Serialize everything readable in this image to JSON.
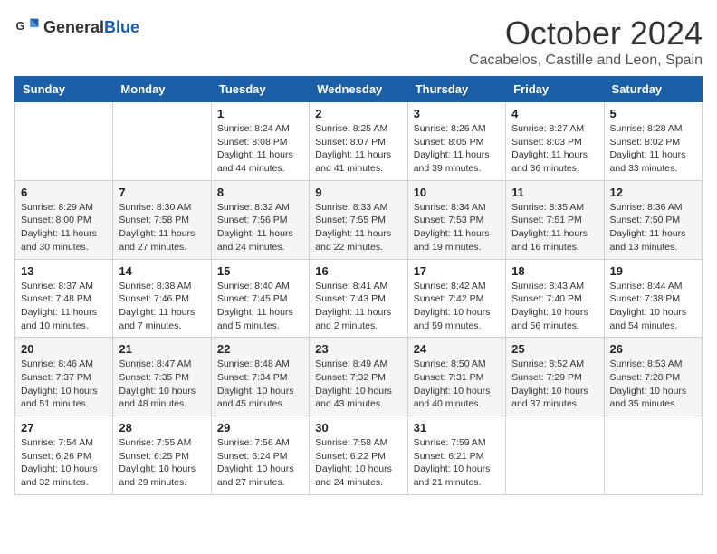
{
  "header": {
    "logo_general": "General",
    "logo_blue": "Blue",
    "month": "October 2024",
    "location": "Cacabelos, Castille and Leon, Spain"
  },
  "days_of_week": [
    "Sunday",
    "Monday",
    "Tuesday",
    "Wednesday",
    "Thursday",
    "Friday",
    "Saturday"
  ],
  "weeks": [
    [
      {
        "day": "",
        "content": ""
      },
      {
        "day": "",
        "content": ""
      },
      {
        "day": "1",
        "content": "Sunrise: 8:24 AM\nSunset: 8:08 PM\nDaylight: 11 hours and 44 minutes."
      },
      {
        "day": "2",
        "content": "Sunrise: 8:25 AM\nSunset: 8:07 PM\nDaylight: 11 hours and 41 minutes."
      },
      {
        "day": "3",
        "content": "Sunrise: 8:26 AM\nSunset: 8:05 PM\nDaylight: 11 hours and 39 minutes."
      },
      {
        "day": "4",
        "content": "Sunrise: 8:27 AM\nSunset: 8:03 PM\nDaylight: 11 hours and 36 minutes."
      },
      {
        "day": "5",
        "content": "Sunrise: 8:28 AM\nSunset: 8:02 PM\nDaylight: 11 hours and 33 minutes."
      }
    ],
    [
      {
        "day": "6",
        "content": "Sunrise: 8:29 AM\nSunset: 8:00 PM\nDaylight: 11 hours and 30 minutes."
      },
      {
        "day": "7",
        "content": "Sunrise: 8:30 AM\nSunset: 7:58 PM\nDaylight: 11 hours and 27 minutes."
      },
      {
        "day": "8",
        "content": "Sunrise: 8:32 AM\nSunset: 7:56 PM\nDaylight: 11 hours and 24 minutes."
      },
      {
        "day": "9",
        "content": "Sunrise: 8:33 AM\nSunset: 7:55 PM\nDaylight: 11 hours and 22 minutes."
      },
      {
        "day": "10",
        "content": "Sunrise: 8:34 AM\nSunset: 7:53 PM\nDaylight: 11 hours and 19 minutes."
      },
      {
        "day": "11",
        "content": "Sunrise: 8:35 AM\nSunset: 7:51 PM\nDaylight: 11 hours and 16 minutes."
      },
      {
        "day": "12",
        "content": "Sunrise: 8:36 AM\nSunset: 7:50 PM\nDaylight: 11 hours and 13 minutes."
      }
    ],
    [
      {
        "day": "13",
        "content": "Sunrise: 8:37 AM\nSunset: 7:48 PM\nDaylight: 11 hours and 10 minutes."
      },
      {
        "day": "14",
        "content": "Sunrise: 8:38 AM\nSunset: 7:46 PM\nDaylight: 11 hours and 7 minutes."
      },
      {
        "day": "15",
        "content": "Sunrise: 8:40 AM\nSunset: 7:45 PM\nDaylight: 11 hours and 5 minutes."
      },
      {
        "day": "16",
        "content": "Sunrise: 8:41 AM\nSunset: 7:43 PM\nDaylight: 11 hours and 2 minutes."
      },
      {
        "day": "17",
        "content": "Sunrise: 8:42 AM\nSunset: 7:42 PM\nDaylight: 10 hours and 59 minutes."
      },
      {
        "day": "18",
        "content": "Sunrise: 8:43 AM\nSunset: 7:40 PM\nDaylight: 10 hours and 56 minutes."
      },
      {
        "day": "19",
        "content": "Sunrise: 8:44 AM\nSunset: 7:38 PM\nDaylight: 10 hours and 54 minutes."
      }
    ],
    [
      {
        "day": "20",
        "content": "Sunrise: 8:46 AM\nSunset: 7:37 PM\nDaylight: 10 hours and 51 minutes."
      },
      {
        "day": "21",
        "content": "Sunrise: 8:47 AM\nSunset: 7:35 PM\nDaylight: 10 hours and 48 minutes."
      },
      {
        "day": "22",
        "content": "Sunrise: 8:48 AM\nSunset: 7:34 PM\nDaylight: 10 hours and 45 minutes."
      },
      {
        "day": "23",
        "content": "Sunrise: 8:49 AM\nSunset: 7:32 PM\nDaylight: 10 hours and 43 minutes."
      },
      {
        "day": "24",
        "content": "Sunrise: 8:50 AM\nSunset: 7:31 PM\nDaylight: 10 hours and 40 minutes."
      },
      {
        "day": "25",
        "content": "Sunrise: 8:52 AM\nSunset: 7:29 PM\nDaylight: 10 hours and 37 minutes."
      },
      {
        "day": "26",
        "content": "Sunrise: 8:53 AM\nSunset: 7:28 PM\nDaylight: 10 hours and 35 minutes."
      }
    ],
    [
      {
        "day": "27",
        "content": "Sunrise: 7:54 AM\nSunset: 6:26 PM\nDaylight: 10 hours and 32 minutes."
      },
      {
        "day": "28",
        "content": "Sunrise: 7:55 AM\nSunset: 6:25 PM\nDaylight: 10 hours and 29 minutes."
      },
      {
        "day": "29",
        "content": "Sunrise: 7:56 AM\nSunset: 6:24 PM\nDaylight: 10 hours and 27 minutes."
      },
      {
        "day": "30",
        "content": "Sunrise: 7:58 AM\nSunset: 6:22 PM\nDaylight: 10 hours and 24 minutes."
      },
      {
        "day": "31",
        "content": "Sunrise: 7:59 AM\nSunset: 6:21 PM\nDaylight: 10 hours and 21 minutes."
      },
      {
        "day": "",
        "content": ""
      },
      {
        "day": "",
        "content": ""
      }
    ]
  ]
}
